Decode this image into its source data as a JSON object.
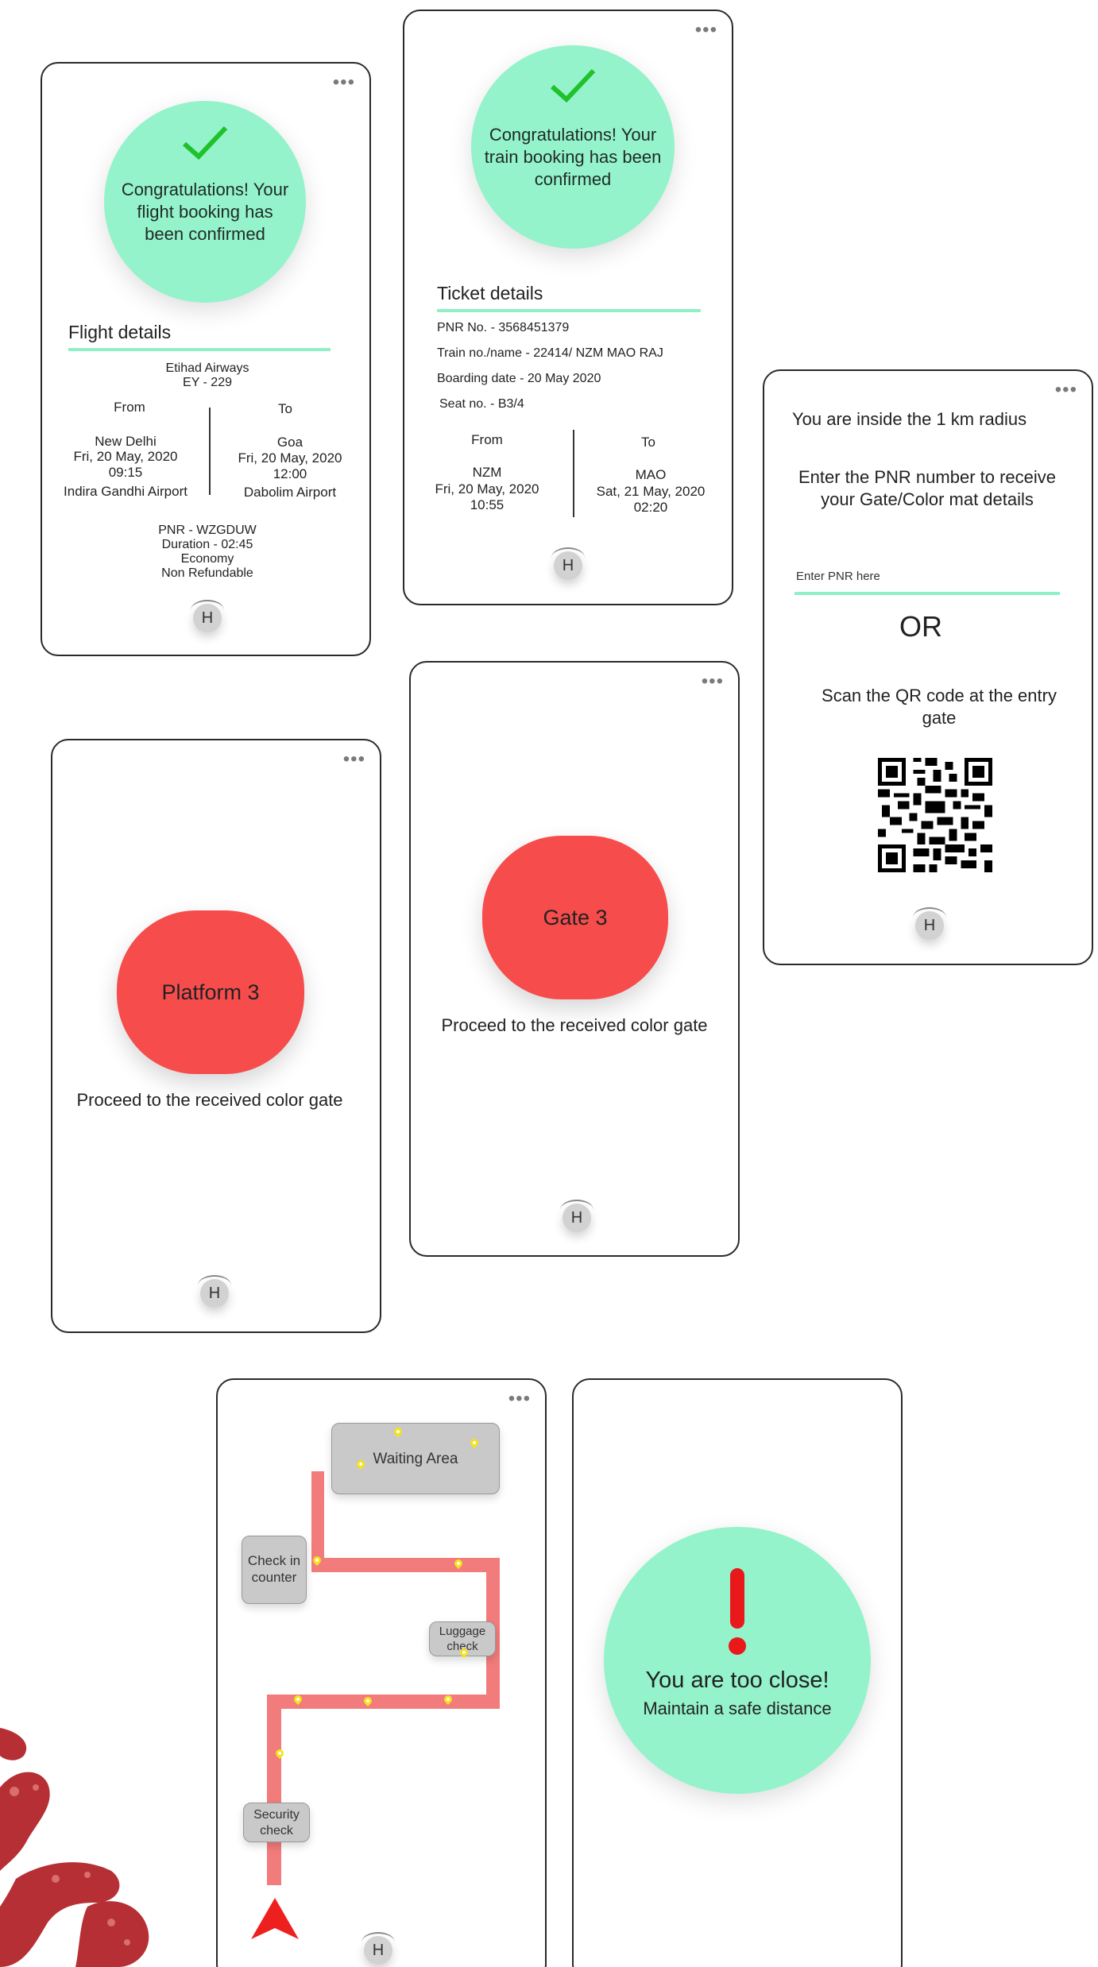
{
  "common": {
    "menu_icon": "more-dots-icon",
    "home_label": "H"
  },
  "flight": {
    "message": "Congratulations! Your flight booking has been confirmed",
    "section_title": "Flight details",
    "airline": "Etihad Airways",
    "flight_no": "EY - 229",
    "from_label": "From",
    "to_label": "To",
    "from": {
      "city": "New Delhi",
      "date": "Fri, 20 May, 2020",
      "time": "09:15",
      "airport": "Indira Gandhi Airport"
    },
    "to": {
      "city": "Goa",
      "date": "Fri, 20 May, 2020",
      "time": "12:00",
      "airport": "Dabolim Airport"
    },
    "pnr": "PNR - WZGDUW",
    "duration": "Duration - 02:45",
    "class": "Economy",
    "refund": "Non Refundable"
  },
  "train": {
    "message": "Congratulations! Your train booking has been confirmed",
    "section_title": "Ticket details",
    "pnr": "PNR No. - 3568451379",
    "train": "Train no./name - 22414/ NZM MAO RAJ",
    "boarding": "Boarding date - 20 May 2020",
    "seat": "Seat no. - B3/4",
    "from_label": "From",
    "to_label": "To",
    "from": {
      "code": "NZM",
      "date": "Fri, 20 May, 2020",
      "time": "10:55"
    },
    "to": {
      "code": "MAO",
      "date": "Sat, 21 May, 2020",
      "time": "02:20"
    }
  },
  "pnr_entry": {
    "radius_text": "You are inside the 1 km radius",
    "instruction": "Enter the PNR number to receive your Gate/Color mat details",
    "placeholder": "Enter PNR here",
    "or": "OR",
    "scan_text": "Scan the QR code at the entry gate",
    "qr_icon": "qr-code-icon"
  },
  "platform": {
    "label": "Platform 3",
    "instruction": "Proceed to the received color gate",
    "color": "#f64c4c"
  },
  "gate": {
    "label": "Gate 3",
    "instruction": "Proceed to the received color gate",
    "color": "#f64c4c"
  },
  "map": {
    "waiting": "Waiting Area",
    "checkin": "Check in counter",
    "luggage": "Luggage check",
    "security": "Security check",
    "path_color": "#f27b7b",
    "pin_color": "#f4e31c"
  },
  "alert": {
    "title": "You are too close!",
    "subtitle": "Maintain a safe distance",
    "icon": "exclamation-icon",
    "color": "#94f3cb"
  }
}
